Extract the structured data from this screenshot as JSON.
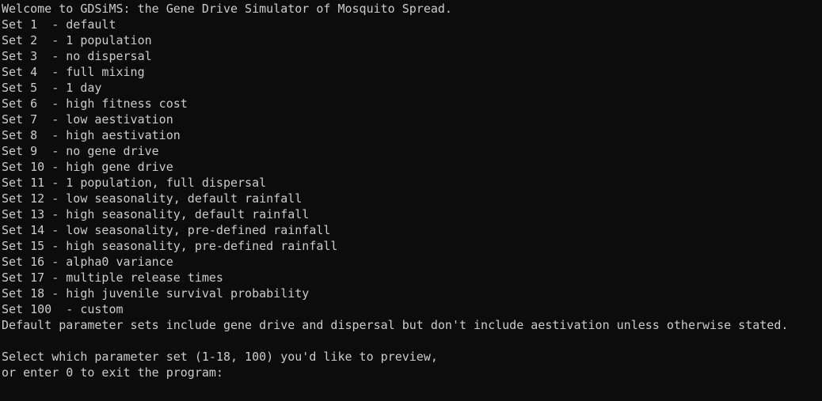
{
  "terminal": {
    "lines": [
      "Welcome to GDSiMS: the Gene Drive Simulator of Mosquito Spread.",
      "Set 1  - default",
      "Set 2  - 1 population",
      "Set 3  - no dispersal",
      "Set 4  - full mixing",
      "Set 5  - 1 day",
      "Set 6  - high fitness cost",
      "Set 7  - low aestivation",
      "Set 8  - high aestivation",
      "Set 9  - no gene drive",
      "Set 10 - high gene drive",
      "Set 11 - 1 population, full dispersal",
      "Set 12 - low seasonality, default rainfall",
      "Set 13 - high seasonality, default rainfall",
      "Set 14 - low seasonality, pre-defined rainfall",
      "Set 15 - high seasonality, pre-defined rainfall",
      "Set 16 - alpha0 variance",
      "Set 17 - multiple release times",
      "Set 18 - high juvenile survival probability",
      "Set 100  - custom",
      "Default parameter sets include gene drive and dispersal but don't include aestivation unless otherwise stated.",
      "",
      "Select which parameter set (1-18, 100) you'd like to preview,"
    ],
    "prompt": "or enter 0 to exit the program:",
    "input_value": ""
  },
  "colors": {
    "background": "#0c0c0c",
    "text": "#cccccc"
  }
}
